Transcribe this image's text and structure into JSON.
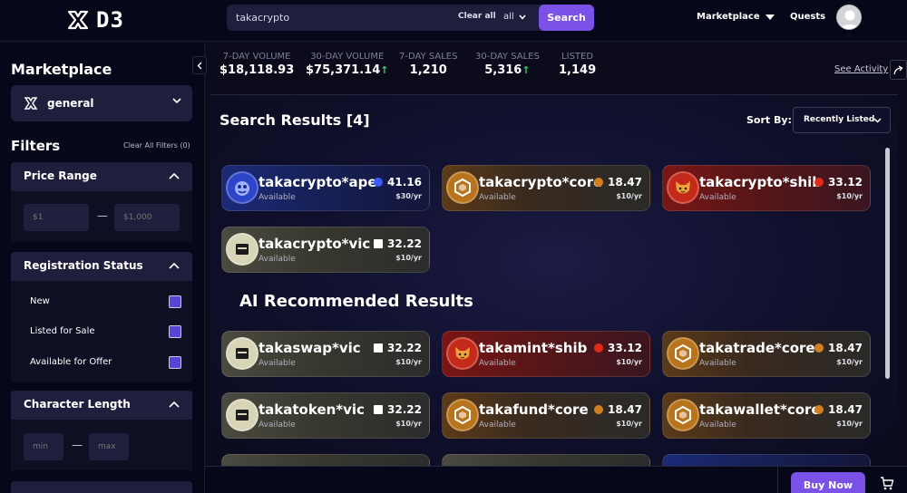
{
  "header": {
    "logo_text": "D3",
    "search_value": "takacrypto",
    "clear_all": "Clear all",
    "scope": "all",
    "search_button": "Search",
    "nav_marketplace": "Marketplace",
    "nav_quests": "Quests"
  },
  "sidebar": {
    "title": "Marketplace",
    "category": "general",
    "filters_title": "Filters",
    "clear_filters": "Clear All Filters (0)",
    "price_range": {
      "title": "Price Range",
      "min_placeholder": "$1",
      "max_placeholder": "$1,000",
      "dash": "—"
    },
    "registration_status": {
      "title": "Registration Status",
      "options": [
        "New",
        "Listed for Sale",
        "Available for Offer"
      ]
    },
    "character_length": {
      "title": "Character Length",
      "min_placeholder": "min",
      "max_placeholder": "max",
      "dash": "—"
    }
  },
  "stats": [
    {
      "label": "7-DAY VOLUME",
      "value": "$18,118.93",
      "up": ""
    },
    {
      "label": "30-DAY VOLUME",
      "value": "$75,371.14",
      "up": "↑"
    },
    {
      "label": "7-DAY SALES",
      "value": "1,210",
      "up": ""
    },
    {
      "label": "30-DAY SALES",
      "value": "5,316",
      "up": "↑"
    },
    {
      "label": "LISTED",
      "value": "1,149",
      "up": ""
    }
  ],
  "see_activity": "See Activity",
  "results": {
    "title": "Search Results [4]",
    "sort_label": "Sort By:",
    "sort_value": "Recently Listed",
    "ai_title": "AI Recommended Results",
    "cards": [
      {
        "name": "takacrypto*ape",
        "status": "Available",
        "price": "41.16",
        "per_year": "$30/yr",
        "chain": "ape"
      },
      {
        "name": "takacrypto*core",
        "status": "Available",
        "price": "18.47",
        "per_year": "$10/yr",
        "chain": "core"
      },
      {
        "name": "takacrypto*shib",
        "status": "Available",
        "price": "33.12",
        "per_year": "$10/yr",
        "chain": "shib"
      },
      {
        "name": "takacrypto*vic",
        "status": "Available",
        "price": "32.22",
        "per_year": "$10/yr",
        "chain": "vic"
      },
      {
        "name": "takaswap*vic",
        "status": "Available",
        "price": "32.22",
        "per_year": "$10/yr",
        "chain": "vic"
      },
      {
        "name": "takamint*shib",
        "status": "Available",
        "price": "33.12",
        "per_year": "$10/yr",
        "chain": "shib"
      },
      {
        "name": "takatrade*core",
        "status": "Available",
        "price": "18.47",
        "per_year": "$10/yr",
        "chain": "core"
      },
      {
        "name": "takatoken*vic",
        "status": "Available",
        "price": "32.22",
        "per_year": "$10/yr",
        "chain": "vic"
      },
      {
        "name": "takafund*core",
        "status": "Available",
        "price": "18.47",
        "per_year": "$10/yr",
        "chain": "core"
      },
      {
        "name": "takawallet*core",
        "status": "Available",
        "price": "18.47",
        "per_year": "$10/yr",
        "chain": "core"
      }
    ]
  },
  "bottom": {
    "buy_now": "Buy Now"
  },
  "colors": {
    "accent": "#7b52e8",
    "background": "#0b0b1c",
    "positive": "#30d46b"
  }
}
